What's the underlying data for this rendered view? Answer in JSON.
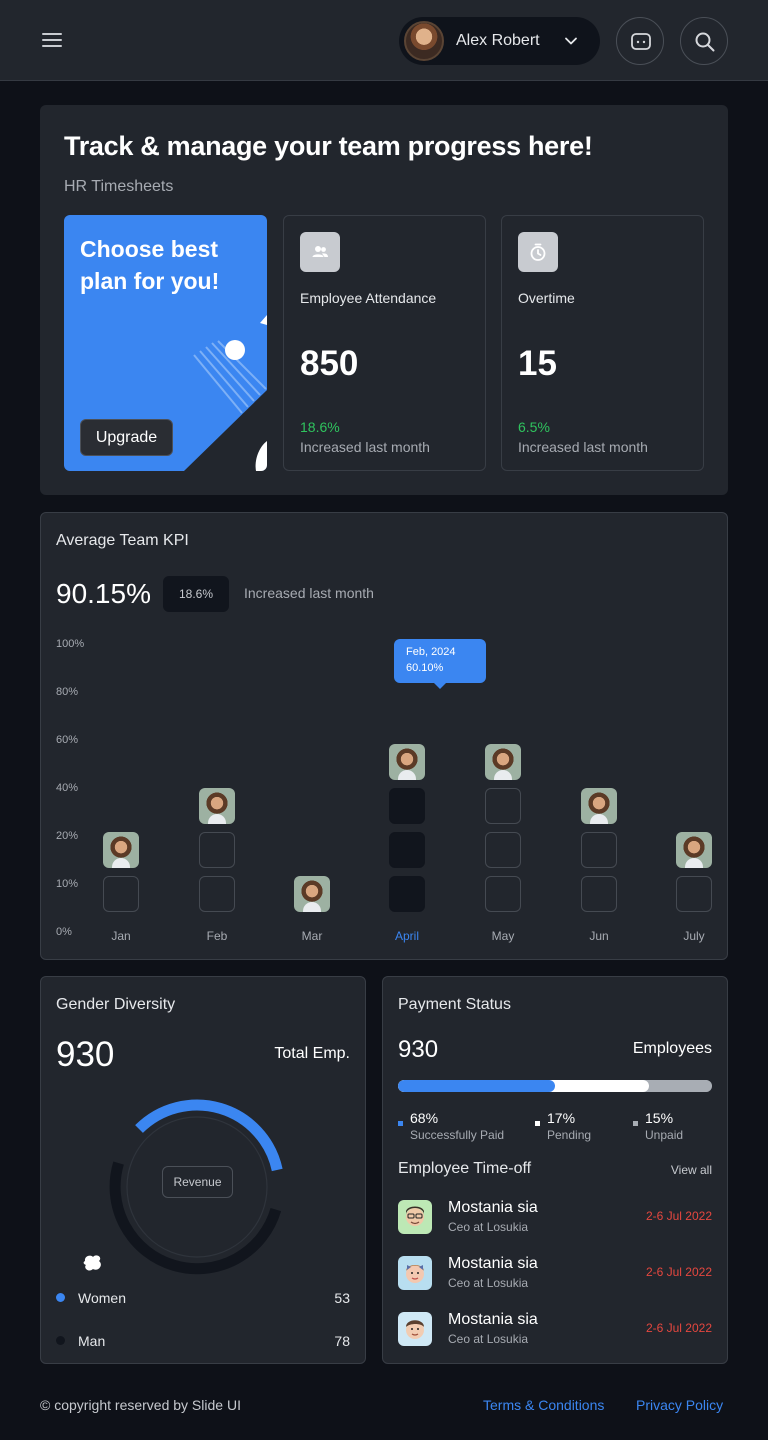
{
  "header": {
    "user_name": "Alex Robert",
    "icons": [
      "hamburger-menu-icon",
      "user-avatar",
      "chevron-down-icon",
      "chat-icon",
      "search-icon"
    ]
  },
  "hero": {
    "title": "Track & manage your team progress here!",
    "subtitle": "HR Timesheets",
    "promo": {
      "title": "Choose best plan for you!",
      "button": "Upgrade"
    },
    "stats": [
      {
        "label": "Employee Attendance",
        "value": "850",
        "pct": "18.6%",
        "note": "Increased last month",
        "icon": "users-icon"
      },
      {
        "label": "Overtime",
        "value": "15",
        "pct": "6.5%",
        "note": "Increased last month",
        "icon": "stopwatch-icon"
      }
    ]
  },
  "kpi": {
    "title": "Average Team KPI",
    "value": "90.15%",
    "badge": "18.6%",
    "note": "Increased last month",
    "tooltip": {
      "label": "Feb, 2024",
      "value": "60.10%"
    }
  },
  "chart_data": {
    "type": "bar",
    "title": "",
    "categories": [
      "Jan",
      "Feb",
      "Mar",
      "April",
      "May",
      "Jun",
      "July"
    ],
    "values": [
      40,
      60,
      20,
      80,
      80,
      60,
      40
    ],
    "y_ticks": [
      "100%",
      "80%",
      "60%",
      "40%",
      "20%",
      "10%",
      "0%"
    ],
    "highlighted_category": "April",
    "ylim": [
      0,
      100
    ],
    "grid": false
  },
  "gender": {
    "title": "Gender Diversity",
    "value": "930",
    "total_label": "Total Emp.",
    "center_label": "Revenue",
    "legend": [
      {
        "label": "Women",
        "count": "53",
        "color": "#3b86f1"
      },
      {
        "label": "Man",
        "count": "78",
        "color": "#11151d"
      }
    ]
  },
  "payment": {
    "title": "Payment Status",
    "value": "930",
    "unit": "Employees",
    "segments": [
      {
        "pct": "68%",
        "label": "Successfully Paid",
        "fraction": 0.5,
        "color": "#3b86f1"
      },
      {
        "pct": "17%",
        "label": "Pending",
        "fraction": 0.3,
        "color": "#ffffff"
      },
      {
        "pct": "15%",
        "label": "Unpaid",
        "fraction": 0.2,
        "color": "#a8adb4"
      }
    ]
  },
  "timeoff": {
    "title": "Employee Time-off",
    "view_all": "View all",
    "rows": [
      {
        "name": "Mostania sia",
        "role": "Ceo at Losukia",
        "date": "2-6 Jul 2022",
        "bg": "#bde8b5"
      },
      {
        "name": "Mostania sia",
        "role": "Ceo at Losukia",
        "date": "2-6 Jul 2022",
        "bg": "#b8def0"
      },
      {
        "name": "Mostania sia",
        "role": "Ceo at Losukia",
        "date": "2-6 Jul 2022",
        "bg": "#cfe8f5"
      }
    ]
  },
  "footer": {
    "copyright": "© copyright reserved by Slide UI",
    "terms": "Terms & Conditions",
    "privacy": "Privacy Policy"
  }
}
